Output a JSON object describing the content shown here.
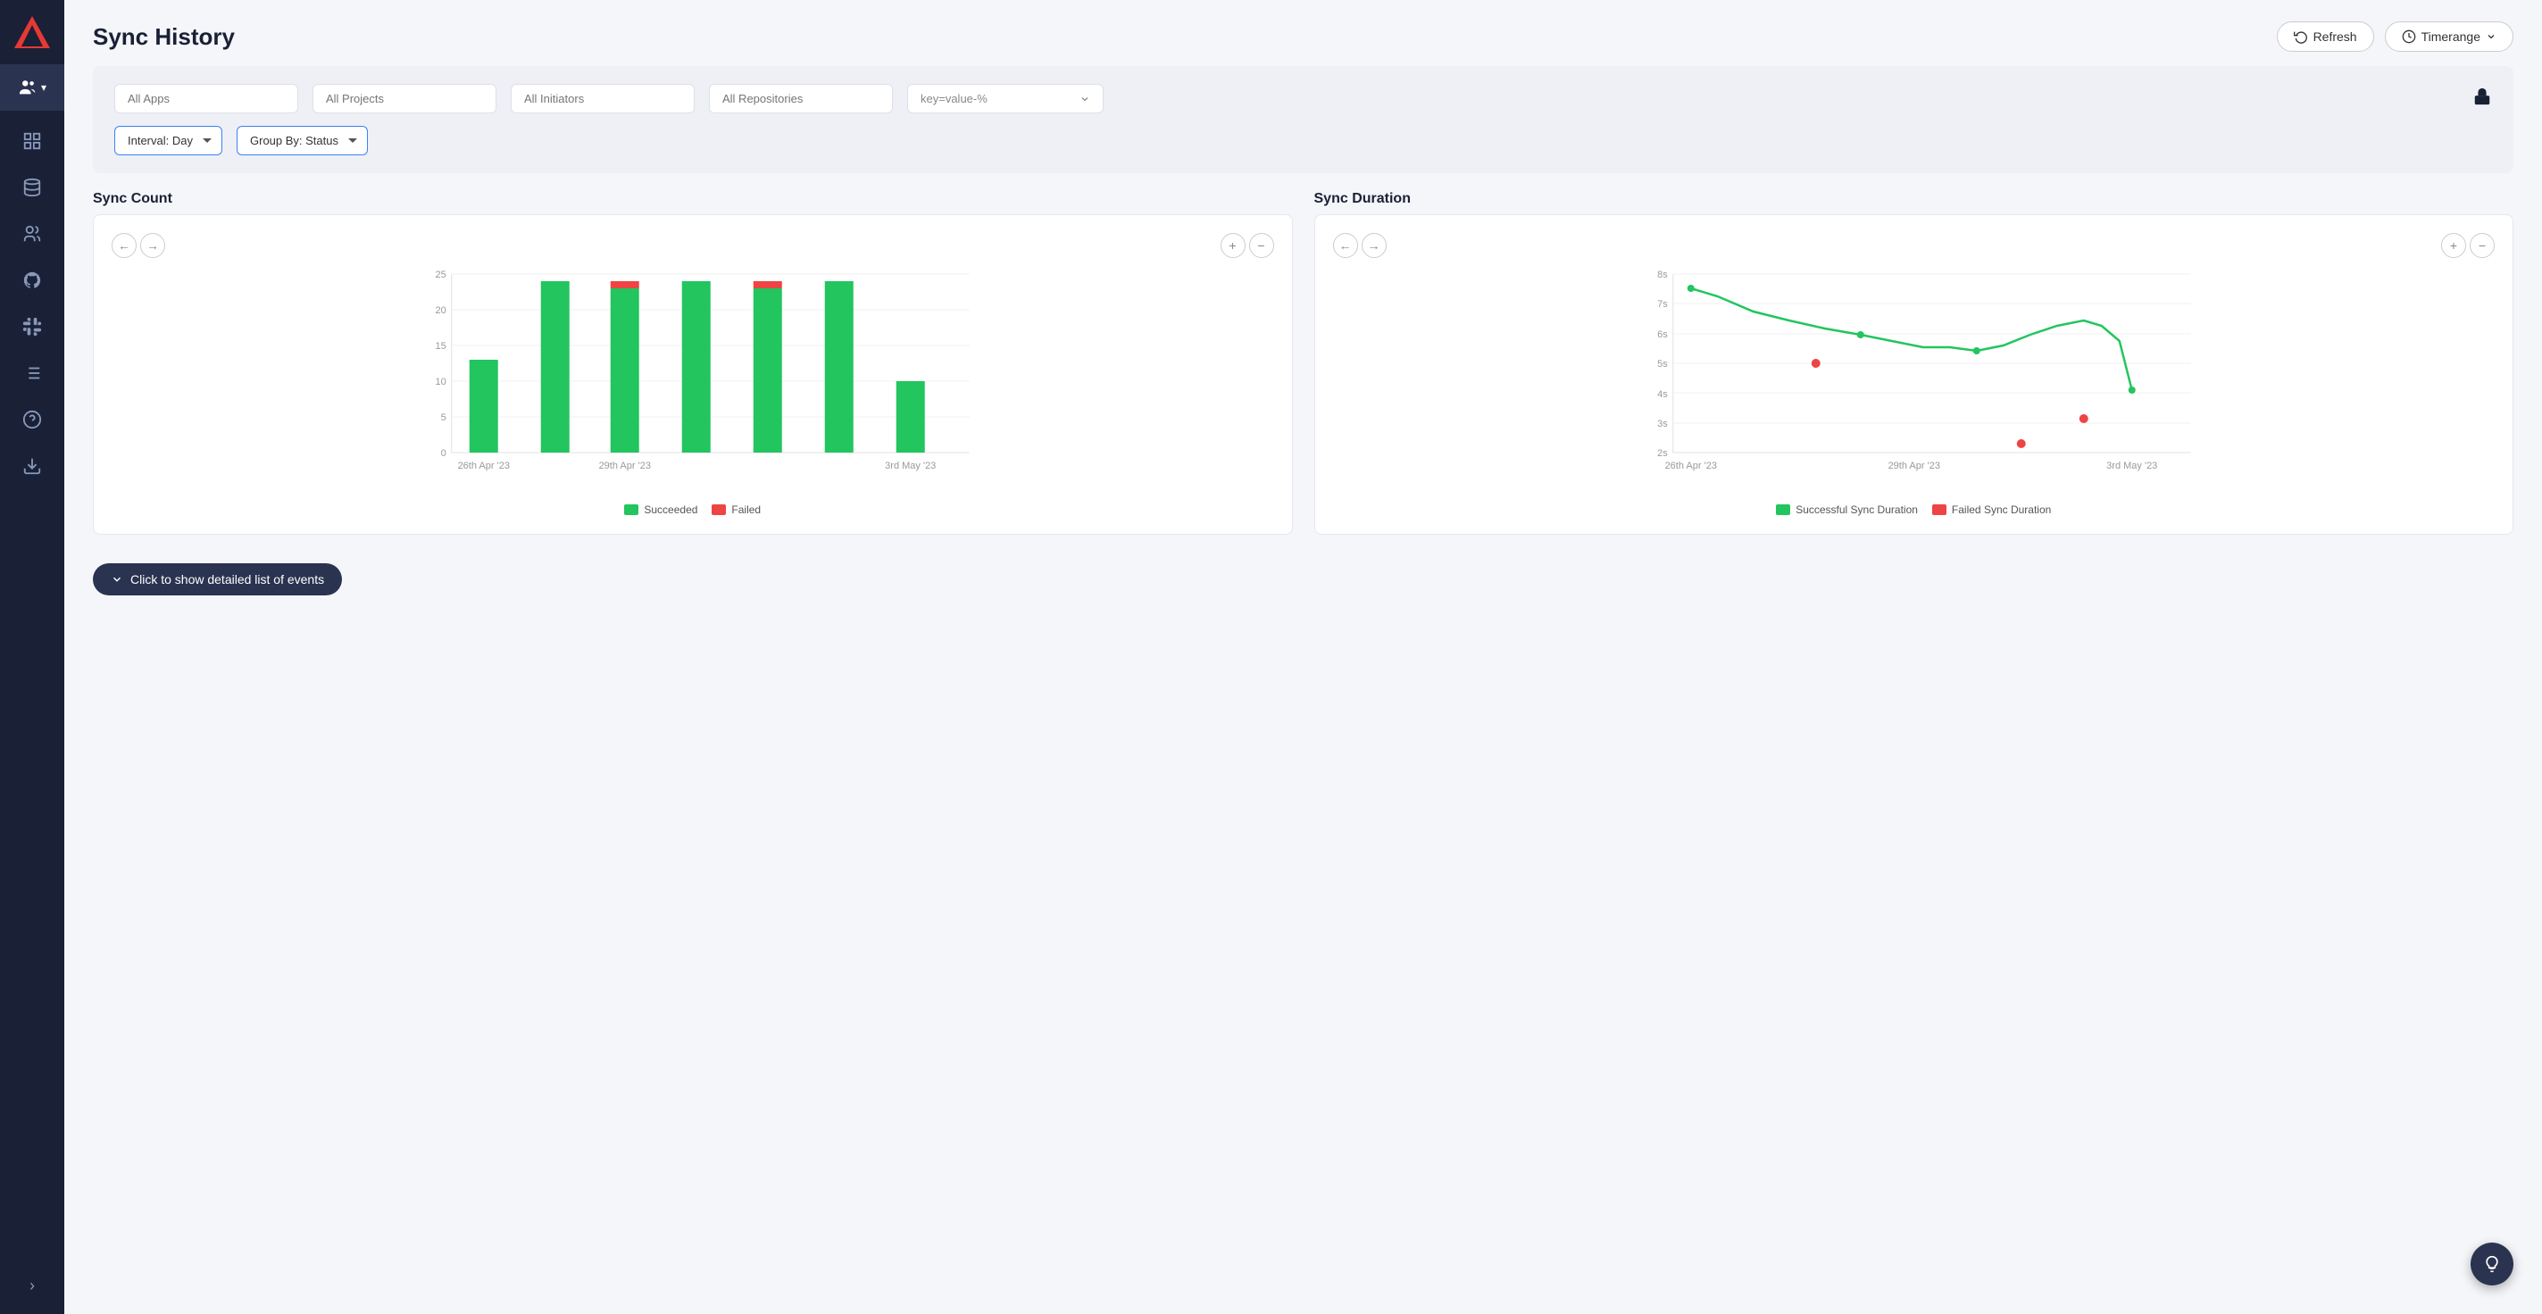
{
  "app": {
    "title": "Sync History"
  },
  "header": {
    "refresh_label": "Refresh",
    "timerange_label": "Timerange"
  },
  "filters": {
    "all_apps_placeholder": "All Apps",
    "all_projects_placeholder": "All Projects",
    "all_initiators_placeholder": "All Initiators",
    "all_repositories_placeholder": "All Repositories",
    "kv_placeholder": "key=value-%",
    "interval_label": "Interval: Day",
    "group_by_label": "Group By: Status"
  },
  "sync_count": {
    "title": "Sync Count",
    "legend": {
      "succeeded": "Succeeded",
      "failed": "Failed"
    },
    "y_axis": [
      "25",
      "20",
      "15",
      "10",
      "5",
      "0"
    ],
    "bars": [
      {
        "label": "26th Apr '23",
        "green": 13,
        "red": 0
      },
      {
        "label": "",
        "green": 24,
        "red": 0
      },
      {
        "label": "29th Apr '23",
        "green": 23,
        "red": 1
      },
      {
        "label": "",
        "green": 24,
        "red": 0
      },
      {
        "label": "",
        "green": 23,
        "red": 1
      },
      {
        "label": "",
        "green": 24,
        "red": 0
      },
      {
        "label": "3rd May '23",
        "green": 10,
        "red": 0
      }
    ]
  },
  "sync_duration": {
    "title": "Sync Duration",
    "legend": {
      "succeeded": "Successful Sync Duration",
      "failed": "Failed Sync Duration"
    },
    "y_labels": [
      "8s",
      "7s",
      "6s",
      "5s",
      "4s",
      "3s",
      "2s"
    ],
    "x_labels": [
      "26th Apr '23",
      "29th Apr '23",
      "3rd May '23"
    ]
  },
  "bottom": {
    "show_events_label": "Click to show detailed list of events"
  },
  "sidebar": {
    "team_label": "▾",
    "items": [
      {
        "icon": "grid-icon",
        "label": "Dashboard"
      },
      {
        "icon": "database-icon",
        "label": "Data"
      },
      {
        "icon": "users-icon",
        "label": "Users"
      },
      {
        "icon": "github-icon",
        "label": "GitHub"
      },
      {
        "icon": "slack-icon",
        "label": "Slack"
      },
      {
        "icon": "list-icon",
        "label": "List"
      },
      {
        "icon": "help-icon",
        "label": "Help"
      },
      {
        "icon": "download-icon",
        "label": "Download"
      }
    ],
    "collapse_label": "›"
  }
}
